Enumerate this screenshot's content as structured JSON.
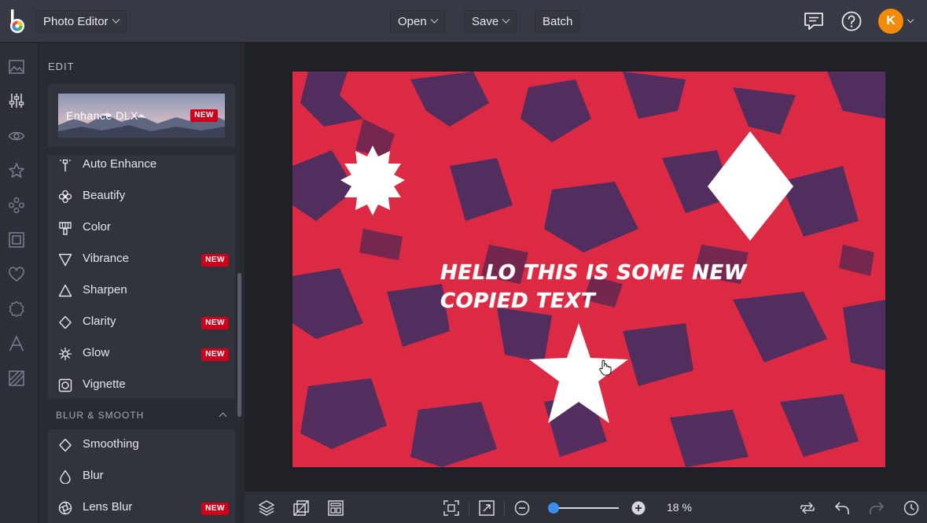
{
  "header": {
    "app_mode": "Photo Editor",
    "open_label": "Open",
    "save_label": "Save",
    "batch_label": "Batch",
    "avatar_initial": "K"
  },
  "rail": {
    "icons": [
      "image-icon",
      "sliders-icon",
      "eye-icon",
      "star-icon",
      "shapes-icon",
      "frame-icon",
      "heart-icon",
      "badge-icon",
      "text-icon",
      "texture-icon"
    ]
  },
  "panel": {
    "title": "EDIT",
    "enhance": {
      "label": "Enhance DLX",
      "badge": "NEW"
    },
    "tools": [
      {
        "label": "Auto Enhance",
        "icon": "magic-wand-icon",
        "badge": ""
      },
      {
        "label": "Beautify",
        "icon": "flower-icon",
        "badge": ""
      },
      {
        "label": "Color",
        "icon": "paint-icon",
        "badge": ""
      },
      {
        "label": "Vibrance",
        "icon": "triangle-down-icon",
        "badge": "NEW"
      },
      {
        "label": "Sharpen",
        "icon": "triangle-up-icon",
        "badge": ""
      },
      {
        "label": "Clarity",
        "icon": "diamond-icon",
        "badge": "NEW"
      },
      {
        "label": "Glow",
        "icon": "sparkle-icon",
        "badge": "NEW"
      },
      {
        "label": "Vignette",
        "icon": "vignette-icon",
        "badge": ""
      }
    ],
    "section": {
      "title": "BLUR & SMOOTH",
      "tools": [
        {
          "label": "Smoothing",
          "icon": "diamond-icon",
          "badge": ""
        },
        {
          "label": "Blur",
          "icon": "drop-icon",
          "badge": ""
        },
        {
          "label": "Lens Blur",
          "icon": "aperture-icon",
          "badge": "NEW"
        }
      ]
    }
  },
  "canvas": {
    "text": "HELLO THIS IS SOME NEW COPIED TEXT",
    "background_color": "#dc2a44",
    "texture_color": "#3b2f63"
  },
  "bottombar": {
    "zoom_level": "18 %",
    "zoom_fraction": 0.08
  },
  "colors": {
    "accent": "#3a8ef0",
    "badge": "#d0021b",
    "avatar": "#f28b0a"
  }
}
